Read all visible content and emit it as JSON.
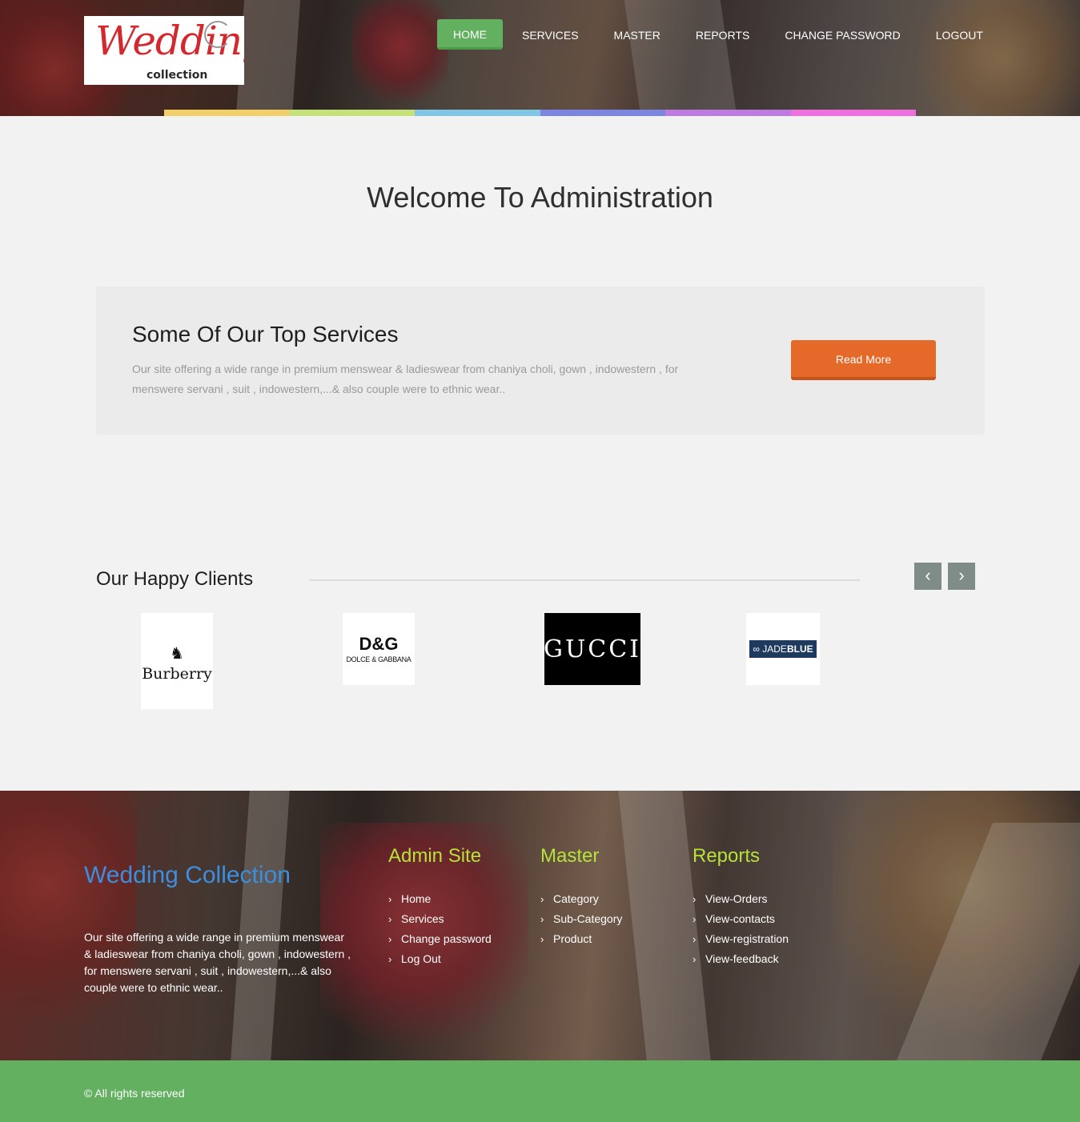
{
  "header": {
    "logo": {
      "script_text": "Wedding",
      "sub_text": "collection"
    },
    "nav": [
      {
        "label": "HOME",
        "active": true
      },
      {
        "label": "SERVICES",
        "active": false
      },
      {
        "label": "MASTER",
        "active": false
      },
      {
        "label": "REPORTS",
        "active": false
      },
      {
        "label": "CHANGE PASSWORD",
        "active": false
      },
      {
        "label": "LOGOUT",
        "active": false
      }
    ],
    "colorbar": [
      "#f3cf6a",
      "#c6e07a",
      "#82c6e5",
      "#7a86e2",
      "#bd7ae0",
      "#f06fdf"
    ]
  },
  "welcome": {
    "title": "Welcome To Administration"
  },
  "services": {
    "title": "Some Of Our Top Services",
    "text": "Our site offering a wide range in premium menswear & ladieswear from chaniya choli, gown , indowestern , for menswere servani , suit , indowestern,...& also couple were to ethnic wear..",
    "button_label": "Read More"
  },
  "clients": {
    "title": "Our Happy Clients",
    "prev_icon": "‹",
    "next_icon": "›",
    "logos": {
      "burberry": {
        "name": "Burberry"
      },
      "dg": {
        "big": "D&G",
        "small": "DOLCE & GABBANA"
      },
      "gucci": {
        "name": "GUCCI"
      },
      "jade": {
        "prefix": "JADE",
        "suffix": "BLUE"
      }
    }
  },
  "footer": {
    "brand": "Wedding Collection",
    "about": "Our site offering a wide range in premium menswear & ladieswear from chaniya choli, gown , indowestern , for menswere servani , suit , indowestern,...& also couple were to ethnic wear..",
    "columns": [
      {
        "title": "Admin Site",
        "links": [
          "Home",
          "Services",
          "Change password",
          "Log Out"
        ]
      },
      {
        "title": "Master",
        "links": [
          "Category",
          "Sub-Category",
          "Product"
        ]
      },
      {
        "title": "Reports",
        "links": [
          "View-Orders",
          "View-contacts",
          "View-registration",
          "View-feedback"
        ]
      }
    ],
    "copyright": "© All rights reserved"
  },
  "colors": {
    "accent_green": "#64b061",
    "button_orange": "#e56a2a",
    "footer_heading": "#b6e23a",
    "footer_brand": "#3a8fe0"
  }
}
